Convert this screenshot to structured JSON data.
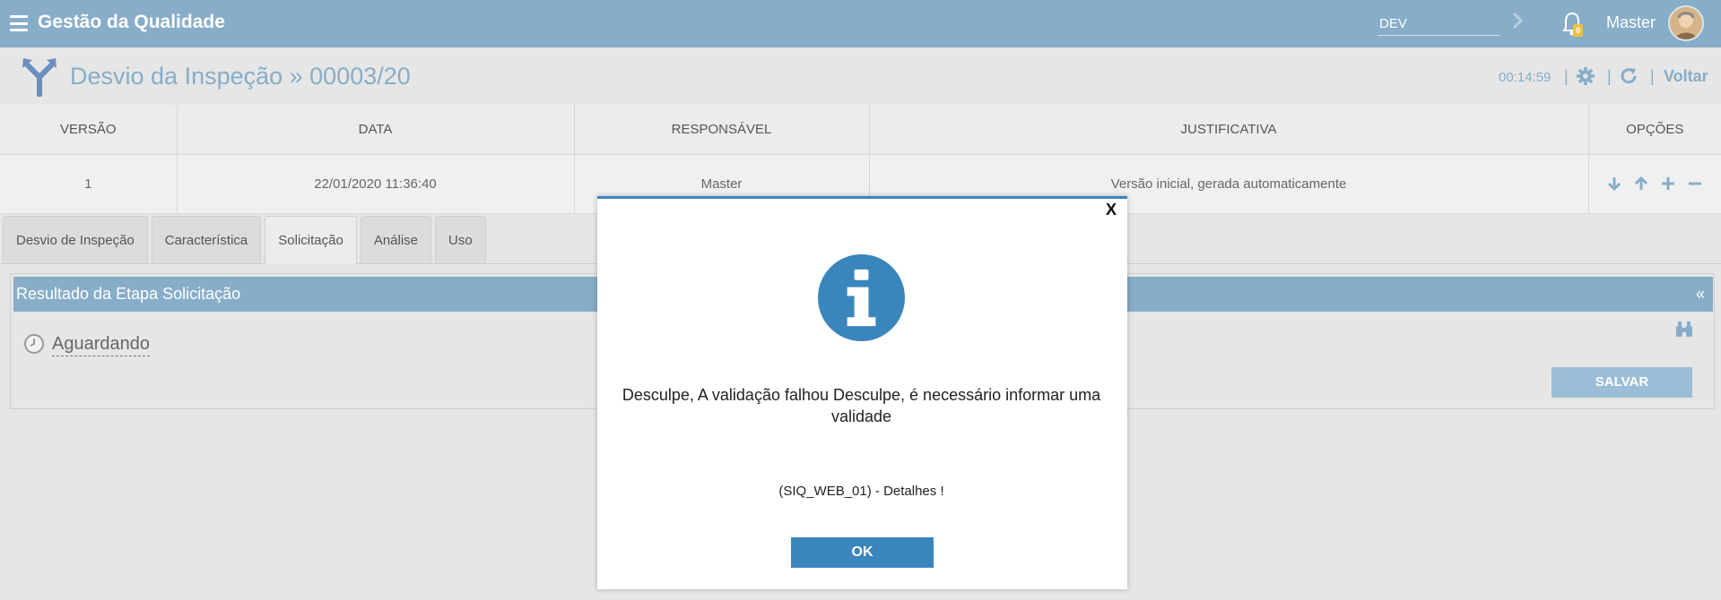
{
  "topbar": {
    "app_title": "Gestão da Qualidade",
    "environment": "DEV",
    "notification_count": "0",
    "user_name": "Master"
  },
  "titlebar": {
    "title": "Desvio da Inspeção » 00003/20",
    "timer": "00:14:59",
    "separator": "|",
    "back_label": "Voltar"
  },
  "versions": {
    "headers": [
      "VERSÃO",
      "DATA",
      "RESPONSÁVEL",
      "JUSTIFICATIVA",
      "OPÇÕES"
    ],
    "rows": [
      {
        "version": "1",
        "date": "22/01/2020 11:36:40",
        "responsible": "Master",
        "justification": "Versão inicial, gerada automaticamente"
      }
    ]
  },
  "tabs": [
    {
      "label": "Desvio de Inspeção"
    },
    {
      "label": "Característica"
    },
    {
      "label": "Solicitação",
      "active": true
    },
    {
      "label": "Análise"
    },
    {
      "label": "Uso"
    }
  ],
  "panel": {
    "title": "Resultado da Etapa Solicitação",
    "collapse_glyph": "«",
    "status": "Aguardando",
    "save_label": "SALVAR"
  },
  "modal": {
    "close_label": "X",
    "message": "Desculpe, A validação falhou Desculpe, é necessário informar uma validade",
    "detail": "(SIQ_WEB_01) - Detalhes !",
    "ok_label": "OK"
  },
  "colors": {
    "topbar": "#87adc8",
    "accent": "#3a86bc",
    "background": "#e6e6e6"
  }
}
